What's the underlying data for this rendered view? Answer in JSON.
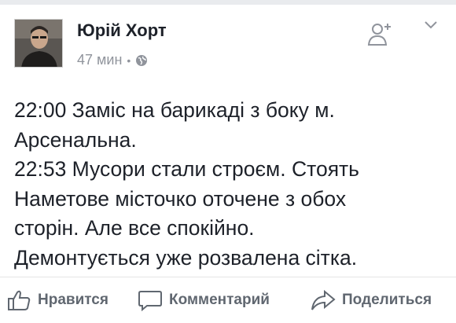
{
  "post": {
    "author": "Юрій Хорт",
    "time": "47 мин",
    "dot": "•",
    "lines": [
      "22:00 Заміс на барикаді з боку м.",
      "Арсенальна.",
      "22:53 Мусори стали строєм. Стоять",
      "Наметове місточко оточене з обох",
      "сторін. Але все спокійно.",
      "Демонтується уже розвалена сітка."
    ]
  },
  "actions": {
    "like": "Нравится",
    "comment": "Комментарий",
    "share": "Поделиться"
  },
  "icons": {
    "avatar": "profile-photo",
    "add_friend": "add-friend-icon",
    "chevron": "chevron-down-icon",
    "audience": "globe-icon",
    "like": "thumbs-up-icon",
    "comment": "comment-bubble-icon",
    "share": "share-arrow-icon"
  },
  "colors": {
    "text": "#1d2129",
    "secondary": "#90949c",
    "action": "#606770"
  }
}
